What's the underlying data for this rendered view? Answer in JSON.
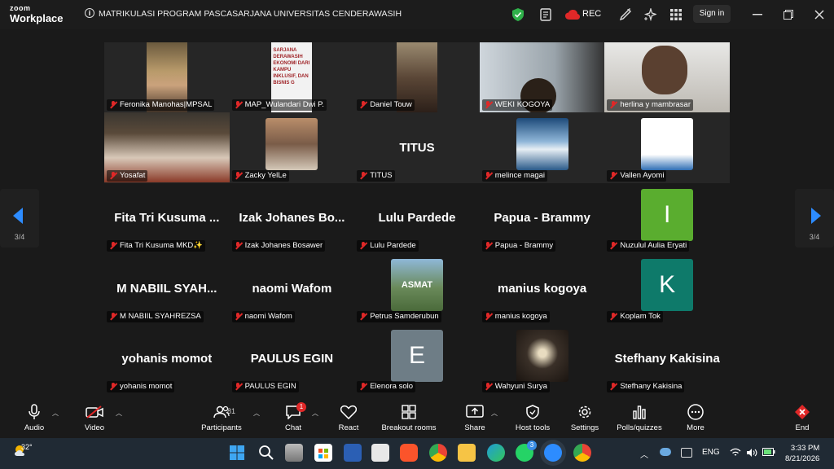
{
  "app": {
    "logo_line1": "zoom",
    "logo_line2": "Workplace",
    "meeting_title": "MATRIKULASI PROGRAM PASCASARJANA UNIVERSITAS CENDERAWASIH"
  },
  "titlebar": {
    "rec_label": "REC",
    "signin_label": "Sign in"
  },
  "pager": {
    "left": "3/4",
    "right": "3/4"
  },
  "tiles": [
    {
      "name": "Feronika Manohas|MPSAL",
      "kind": "video"
    },
    {
      "name": "MAP_Wulandari Dwi P.",
      "kind": "slide",
      "slide_text": "SARJANA\nDERAWASIH\nEKONOMI DARI KAMPU\nINKLUSIF, DAN BISNIS G"
    },
    {
      "name": "Daniel Touw",
      "kind": "video"
    },
    {
      "name": "WEKI KOGOYA",
      "kind": "video"
    },
    {
      "name": "herlina y mambrasar",
      "kind": "video"
    },
    {
      "name": "Yosafat",
      "kind": "video"
    },
    {
      "name": "Zacky YelLe",
      "kind": "image"
    },
    {
      "name": "TITUS",
      "kind": "text",
      "display": "TITUS"
    },
    {
      "name": "melince magai",
      "kind": "image"
    },
    {
      "name": "Vallen Ayomi",
      "kind": "image"
    },
    {
      "name": "Fita Tri Kusuma MKD✨",
      "kind": "text",
      "display": "Fita Tri Kusuma ..."
    },
    {
      "name": "Izak Johanes Bosawer",
      "kind": "text",
      "display": "Izak Johanes Bo..."
    },
    {
      "name": "Lulu Pardede",
      "kind": "text",
      "display": "Lulu Pardede"
    },
    {
      "name": "Papua - Brammy",
      "kind": "text",
      "display": "Papua - Brammy"
    },
    {
      "name": "Nuzulul Aulia Eryati",
      "kind": "avatar",
      "letter": "I"
    },
    {
      "name": "M NABIIL SYAHREZSA",
      "kind": "text",
      "display": "M NABIIL SYAH..."
    },
    {
      "name": "naomi Wafom",
      "kind": "text",
      "display": "naomi Wafom"
    },
    {
      "name": "Petrus Samderubun",
      "kind": "image",
      "img_text": "ASMAT"
    },
    {
      "name": "manius kogoya",
      "kind": "text",
      "display": "manius kogoya"
    },
    {
      "name": "Koplam Tok",
      "kind": "avatar",
      "letter": "K"
    },
    {
      "name": "yohanis momot",
      "kind": "text",
      "display": "yohanis momot"
    },
    {
      "name": "PAULUS EGIN",
      "kind": "text",
      "display": "PAULUS EGIN"
    },
    {
      "name": "Elenora solo",
      "kind": "avatar",
      "letter": "E"
    },
    {
      "name": "Wahyuni Surya",
      "kind": "image"
    },
    {
      "name": "Stefhany Kakisina",
      "kind": "text",
      "display": "Stefhany Kakisina"
    }
  ],
  "toolbar": {
    "audio": "Audio",
    "video": "Video",
    "participants": "Participants",
    "participants_count": "81",
    "chat": "Chat",
    "chat_badge": "1",
    "react": "React",
    "breakout": "Breakout rooms",
    "share": "Share",
    "host_tools": "Host tools",
    "settings": "Settings",
    "polls": "Polls/quizzes",
    "more": "More",
    "end": "End"
  },
  "taskbar": {
    "temp": "32°",
    "lang": "ENG",
    "time": "3:33 PM",
    "date": "8/21/2026",
    "zoom_badge": "3"
  },
  "colors": {
    "green_avatar": "#5aad2f",
    "teal_avatar": "#0e7a6a",
    "gray_avatar": "#6e7d86",
    "mute_red": "#e02828",
    "end_red": "#e02828"
  }
}
